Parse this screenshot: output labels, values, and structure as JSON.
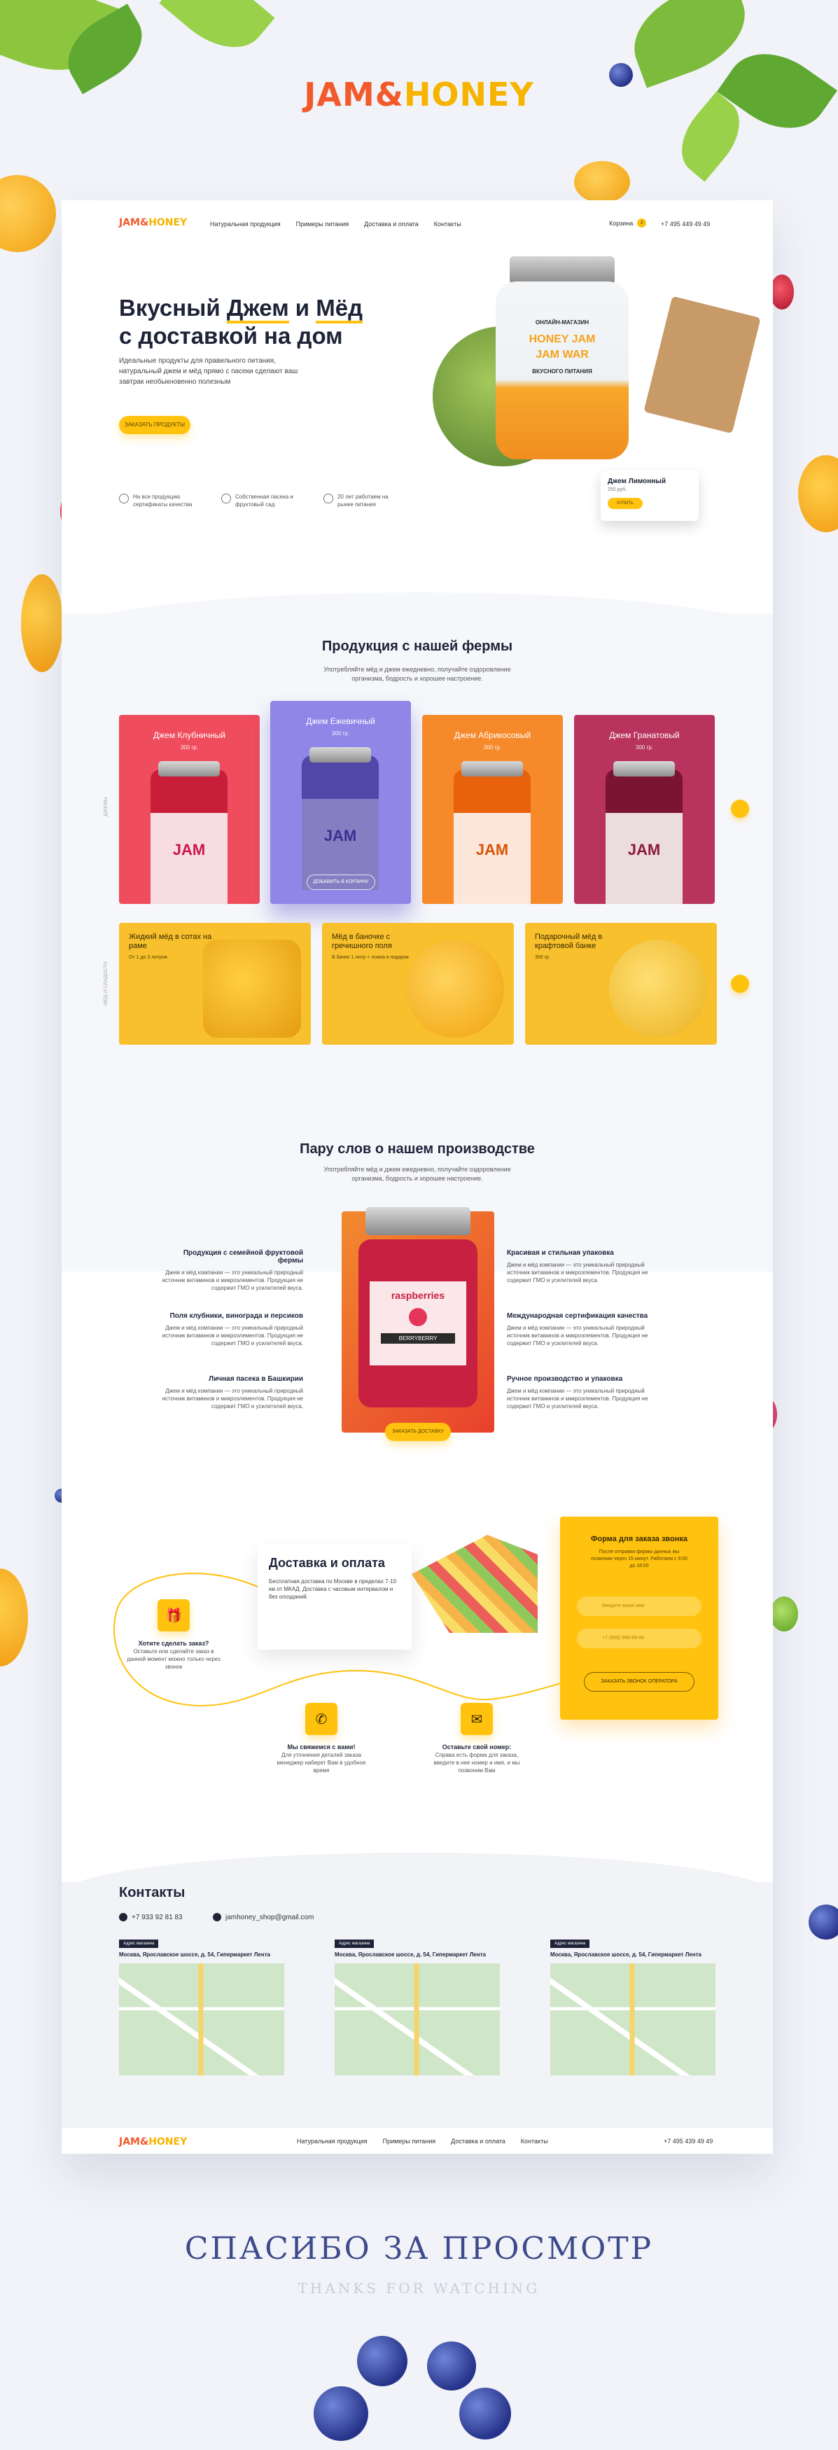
{
  "brand": {
    "logo_part1": "JAM&",
    "logo_part2": "HONEY"
  },
  "nav": {
    "links": [
      "Натуральная продукция",
      "Примеры питания",
      "Доставка и оплата",
      "Контакты"
    ],
    "cart_label": "Корзина",
    "cart_count": "2",
    "phone": "+7 495 449 49 49"
  },
  "hero": {
    "title_line1_a": "Вкусный ",
    "title_line1_b": "Джем",
    "title_line1_c": " и ",
    "title_line1_d": "Мёд",
    "title_line2": "с доставкой на дом",
    "description": "Идеальные продукты для правильного питания, натуральный джем и мёд прямо с пасеки сделают ваш завтрак необыкновенно полезным",
    "cta": "ЗАКАЗАТЬ ПРОДУКТЫ",
    "features": [
      "На все продукцию сертификаты качества",
      "Собственная пасека и фруктовый сад",
      "20 лет работаем на рынке питания"
    ],
    "jar_label_top": "ОНЛАЙН-МАГАЗИН",
    "jar_label_main1": "HONEY JAM",
    "jar_label_main2": "JAM WAR",
    "jar_label_bottom": "ВКУСНОГО ПИТАНИЯ",
    "price_card_title": "Джем Лимонный",
    "price_card_weight": "250 руб.",
    "price_card_btn": "КУПИТЬ"
  },
  "products": {
    "title": "Продукция с нашей фермы",
    "subtitle": "Употребляйте мёд и джем ежедневно, получайте оздоровление организма, бодрость и хорошее настроение.",
    "side_label": "ДЖЕМЫ",
    "items": [
      {
        "name": "Джем Клубничный",
        "weight": "300 гр.",
        "color": "#ef4d5d",
        "label": "JAM"
      },
      {
        "name": "Джем Ежевичный",
        "weight": "300 гр.",
        "color": "#8f86e8",
        "label": "JAM",
        "btn": "ДОБАВИТЬ В КОРЗИНУ"
      },
      {
        "name": "Джем Абрикосовый",
        "weight": "300 гр.",
        "color": "#f68a2b",
        "label": "JAM"
      },
      {
        "name": "Джем Гранатовый",
        "weight": "300 гр.",
        "color": "#b8335e",
        "label": "JAM"
      }
    ]
  },
  "honey": {
    "side_label": "МЁД И СЛАДОСТИ",
    "items": [
      {
        "name": "Жидкий мёд в сотах на раме",
        "weight": "От 1 до 3 литров"
      },
      {
        "name": "Мёд в баночке с гречишного поля",
        "weight": "В банке 1 литр + ложка в подарок"
      },
      {
        "name": "Подарочный мёд в крафтовой банке",
        "weight": "350 гр."
      }
    ]
  },
  "production": {
    "title": "Пару слов о нашем производстве",
    "subtitle": "Употребляйте мёд и джем ежедневно, получайте оздоровление организма, бодрость и хорошее настроение.",
    "left": [
      {
        "title": "Продукция с семейной фруктовой фермы",
        "text": "Джем и мёд компании — это уникальный природный источник витаминов и микроэлементов. Продукция не содержит ГМО и усилителей вкуса."
      },
      {
        "title": "Поля клубники, винограда и персиков",
        "text": "Джем и мёд компании — это уникальный природный источник витаминов и микроэлементов. Продукция не содержит ГМО и усилителей вкуса."
      },
      {
        "title": "Личная пасека в Башкирии",
        "text": "Джем и мёд компании — это уникальный природный источник витаминов и микроэлементов. Продукция не содержит ГМО и усилителей вкуса."
      }
    ],
    "right": [
      {
        "title": "Красивая и стильная упаковка",
        "text": "Джем и мёд компании — это уникальный природный источник витаминов и микроэлементов. Продукция не содержит ГМО и усилителей вкуса."
      },
      {
        "title": "Международная сертификация качества",
        "text": "Джем и мёд компании — это уникальный природный источник витаминов и микроэлементов. Продукция не содержит ГМО и усилителей вкуса."
      },
      {
        "title": "Ручное производство и упаковка",
        "text": "Джем и мёд компании — это уникальный природный источник витаминов и микроэлементов. Продукция не содержит ГМО и усилителей вкуса."
      }
    ],
    "jar_label": "raspberries",
    "jar_brand": "BERRYBERRY",
    "cta": "ЗАКАЗАТЬ ДОСТАВКУ"
  },
  "delivery": {
    "title": "Доставка и оплата",
    "description": "Бесплатная доставка по Москве в пределах 7-10 км от МКАД. Доставка с часовым интервалом и без опозданий.",
    "steps": [
      {
        "title": "Хотите сделать заказ?",
        "text": "Оставьте или сделайте заказ в данной момент можно только через звонок"
      },
      {
        "title": "Мы свяжемся с вами!",
        "text": "Для уточнения деталей заказа менеджер наберет Вам в удобное время"
      },
      {
        "title": "Оставьте свой номер:",
        "text": "Справа есть форма для заказа, введите в нее номер и имя, и мы позвоним Вам"
      }
    ],
    "form_title": "Форма для заказа звонка",
    "form_subtitle": "После отправки формы данных мы позвоним через 15 минут. Работаем с 9:00 до 18:00",
    "form_name_placeholder": "Введите ваше имя",
    "form_phone_placeholder": "+7 (999) 999-99-99",
    "form_button": "ЗАКАЗАТЬ ЗВОНОК ОПЕРАТОРА"
  },
  "contacts": {
    "title": "Контакты",
    "phone": "+7 933 92 81 83",
    "email": "jamhoney_shop@gmail.com",
    "addresses": [
      {
        "tag": "Адрес магазина",
        "text": "Москва, Ярославское шоссе, д. 54, Гипермаркет Лента"
      },
      {
        "tag": "Адрес магазина",
        "text": "Москва, Ярославское шоссе, д. 54, Гипермаркет Лента"
      },
      {
        "tag": "Адрес магазина",
        "text": "Москва, Ярославское шоссе, д. 54, Гипермаркет Лента"
      }
    ]
  },
  "footer": {
    "links": [
      "Натуральная продукция",
      "Примеры питания",
      "Доставка и оплата",
      "Контакты"
    ],
    "phone": "+7 495 439 49 49"
  },
  "thanks": {
    "ru": "СПАСИБО ЗА ПРОСМОТР",
    "en": "THANKS FOR WATCHING"
  },
  "colors": {
    "accent": "#ffc20e",
    "dark": "#1e2338",
    "brand_red": "#f25a2b"
  }
}
